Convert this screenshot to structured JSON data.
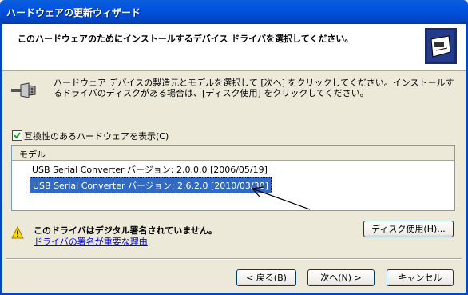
{
  "window": {
    "title": "ハードウェアの更新ウィザード"
  },
  "header": {
    "instruction": "このハードウェアのためにインストールするデバイス ドライバを選択してください。",
    "icon": "hardware-card-icon"
  },
  "intro": {
    "text": "ハードウェア デバイスの製造元とモデルを選択して [次へ] をクリックしてください。インストールするドライバのディスクがある場合は、[ディスク使用] をクリックしてください。",
    "icon": "serial-connector-icon"
  },
  "compat_checkbox": {
    "label": "互換性のあるハードウェアを表示(C)",
    "checked": true
  },
  "model_list": {
    "header": "モデル",
    "items": [
      {
        "label": "USB Serial Converter バージョン: 2.0.0.0 [2006/05/19]",
        "selected": false
      },
      {
        "label": "USB Serial Converter バージョン: 2.6.2.0 [2010/03/30]",
        "selected": true
      }
    ]
  },
  "warning": {
    "text": "このドライバはデジタル署名されていません。",
    "link": "ドライバの署名が重要な理由",
    "icon": "warning-icon"
  },
  "buttons": {
    "have_disk": "ディスク使用(H)...",
    "back": "< 戻る(B)",
    "next": "次へ(N) >",
    "cancel": "キャンセル"
  },
  "colors": {
    "titlebar": "#0054e3",
    "selection": "#316ac5",
    "dialog_bg": "#ece9d8"
  }
}
